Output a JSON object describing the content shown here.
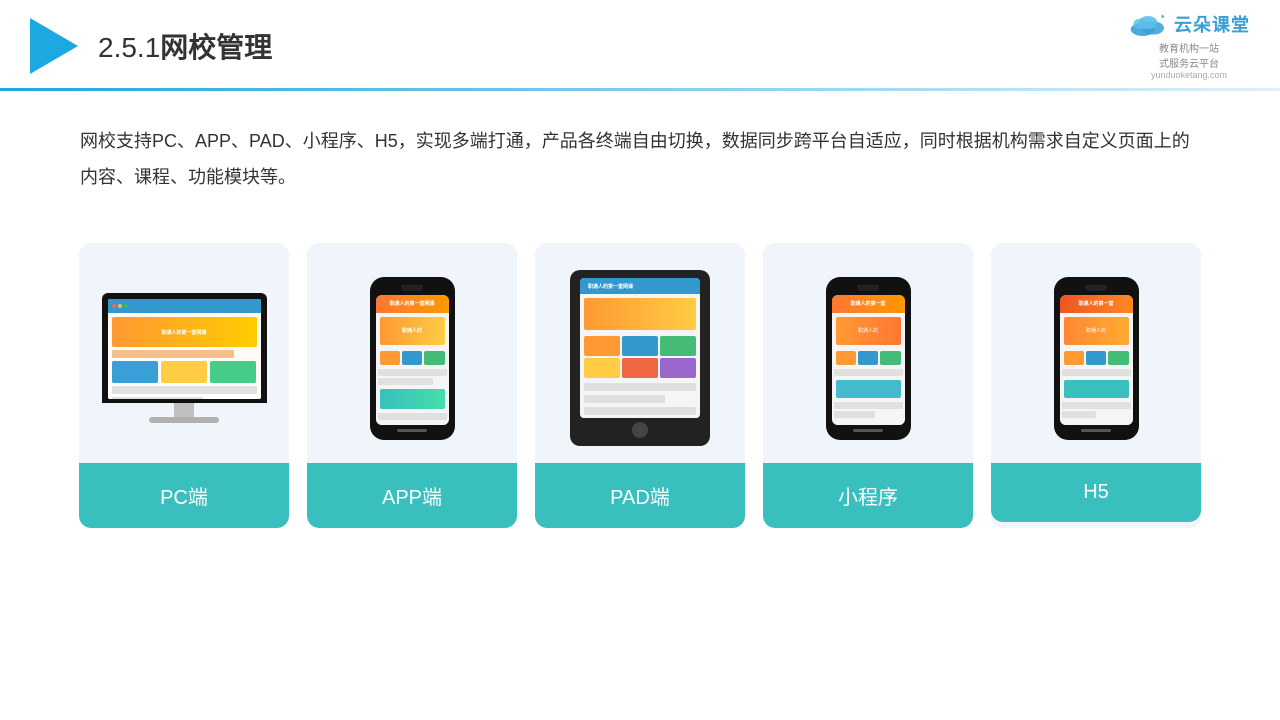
{
  "header": {
    "title": "2.5.1网校管理",
    "logo_name": "云朵课堂",
    "logo_sub": "yunduoketang.com",
    "logo_tag1": "教育机构一站",
    "logo_tag2": "式服务云平台"
  },
  "description": {
    "text": "网校支持PC、APP、PAD、小程序、H5，实现多端打通，产品各终端自由切换，数据同步跨平台自适应，同时根据机构需求自定义页面上的内容、课程、功能模块等。"
  },
  "cards": [
    {
      "id": "pc",
      "label": "PC端",
      "type": "pc"
    },
    {
      "id": "app",
      "label": "APP端",
      "type": "phone"
    },
    {
      "id": "pad",
      "label": "PAD端",
      "type": "tablet"
    },
    {
      "id": "miniapp",
      "label": "小程序",
      "type": "phone2"
    },
    {
      "id": "h5",
      "label": "H5",
      "type": "phone3"
    }
  ],
  "colors": {
    "teal": "#3abfbf",
    "blue": "#1ca8e0",
    "header_line_start": "#1ca8e0",
    "card_bg": "#f0f5fc"
  }
}
